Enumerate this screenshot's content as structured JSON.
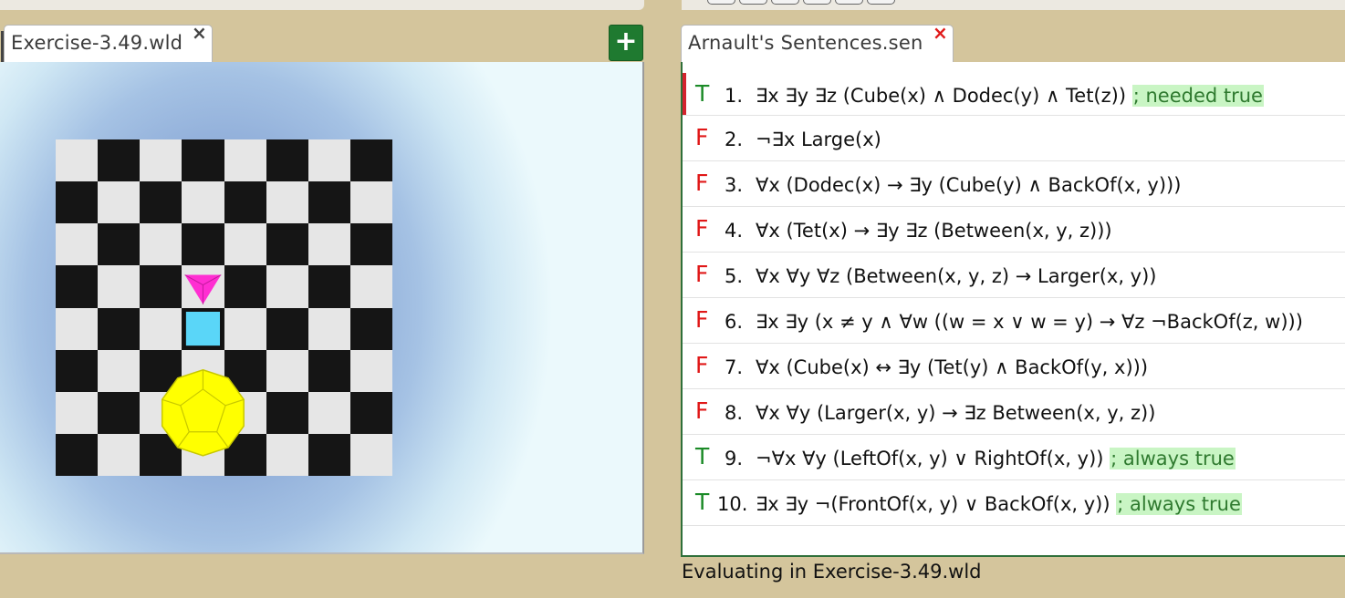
{
  "theme": {
    "background": "#d4c59c",
    "true_color": "#1b8a27",
    "false_color": "#e01818",
    "comment_bg": "#c9f5c4"
  },
  "world_tab": {
    "title": "Exercise-3.49.wld",
    "close": "×"
  },
  "add_button": {
    "label": "+"
  },
  "sentence_tab": {
    "title": "Arnault's Sentences.sen",
    "close": "×"
  },
  "world": {
    "board_size": 8,
    "blocks": [
      {
        "shape": "tetrahedron",
        "size": "small",
        "color": "#ff2ed2",
        "col": 3,
        "row": 3
      },
      {
        "shape": "cube",
        "size": "small",
        "color": "#5ad6f8",
        "col": 3,
        "row": 4
      },
      {
        "shape": "dodecahedron",
        "size": "large",
        "color": "#ffff00",
        "col": 3,
        "row": 6
      }
    ]
  },
  "sentences": [
    {
      "truth": "T",
      "num": "1.",
      "formula": "∃x ∃y ∃z (Cube(x) ∧ Dodec(y) ∧ Tet(z))",
      "comment": "; needed true",
      "selected": true
    },
    {
      "truth": "F",
      "num": "2.",
      "formula": "¬∃x Large(x)",
      "comment": ""
    },
    {
      "truth": "F",
      "num": "3.",
      "formula": "∀x (Dodec(x) → ∃y (Cube(y) ∧ BackOf(x, y)))",
      "comment": ""
    },
    {
      "truth": "F",
      "num": "4.",
      "formula": "∀x (Tet(x) → ∃y ∃z (Between(x, y, z)))",
      "comment": ""
    },
    {
      "truth": "F",
      "num": "5.",
      "formula": "∀x ∀y ∀z (Between(x, y, z) → Larger(x, y))",
      "comment": ""
    },
    {
      "truth": "F",
      "num": "6.",
      "formula": "∃x ∃y (x ≠ y ∧ ∀w ((w = x ∨ w = y) → ∀z ¬BackOf(z, w)))",
      "comment": ""
    },
    {
      "truth": "F",
      "num": "7.",
      "formula": "∀x (Cube(x) ↔ ∃y (Tet(y) ∧ BackOf(y, x)))",
      "comment": ""
    },
    {
      "truth": "F",
      "num": "8.",
      "formula": "∀x ∀y (Larger(x, y) → ∃z Between(x, y, z))",
      "comment": ""
    },
    {
      "truth": "T",
      "num": "9.",
      "formula": "¬∀x ∀y (LeftOf(x, y) ∨ RightOf(x, y))",
      "comment": "; always true"
    },
    {
      "truth": "T",
      "num": "10.",
      "formula": "∃x ∃y ¬(FrontOf(x, y) ∨ BackOf(x, y))",
      "comment": "; always true"
    }
  ],
  "status": "Evaluating in Exercise-3.49.wld"
}
